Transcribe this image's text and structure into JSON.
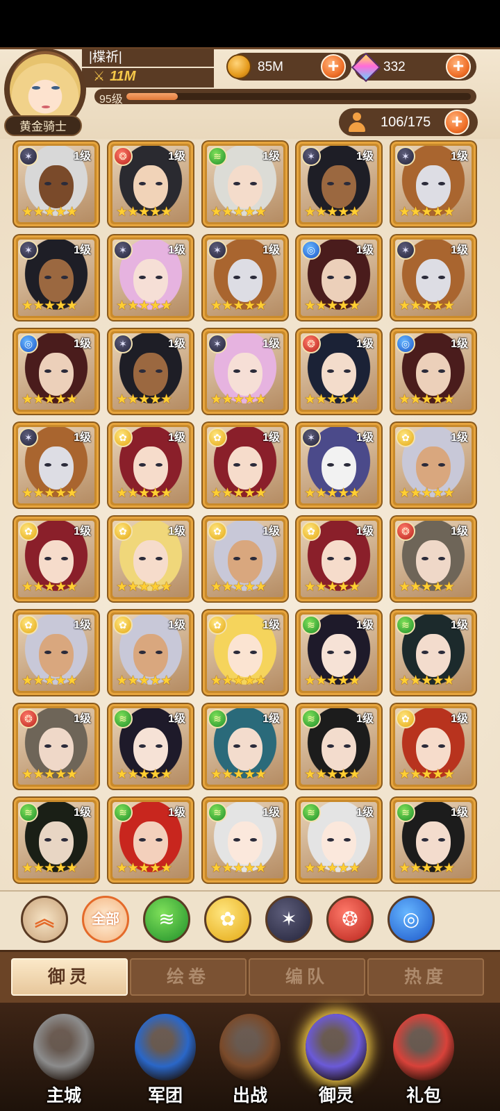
{
  "player": {
    "name": "|楪祈|",
    "power": "11M",
    "level_label": "95级",
    "level_progress": 0.15,
    "rank_title": "黄金骑士"
  },
  "resources": {
    "coins": "85M",
    "gems": "332",
    "roster_count": "106/175"
  },
  "colors": {
    "accent": "#f0712a",
    "frame": "#e7a53e",
    "brown": "#5a3b24"
  },
  "heroes": [
    {
      "element": "dark",
      "level": "1级",
      "stars": "★★★★★",
      "hair": "#d8d8d8",
      "skin": "#7a4a2a"
    },
    {
      "element": "fire",
      "level": "1级",
      "stars": "★★★★★",
      "hair": "#2a2a30",
      "skin": "#f1d3b8"
    },
    {
      "element": "wind",
      "level": "1级",
      "stars": "★★★★★",
      "hair": "#dcdcd6",
      "skin": "#f4dccb"
    },
    {
      "element": "dark",
      "level": "1级",
      "stars": "★★★★★",
      "hair": "#1e1e26",
      "skin": "#9b6840"
    },
    {
      "element": "dark",
      "level": "1级",
      "stars": "★★★★★",
      "hair": "#a9652f",
      "skin": "#dddde4"
    },
    {
      "element": "dark",
      "level": "1级",
      "stars": "★★★★★",
      "hair": "#1e1e26",
      "skin": "#9b6840"
    },
    {
      "element": "dark",
      "level": "1级",
      "stars": "★★★★★",
      "hair": "#e6b3e0",
      "skin": "#f6dfd6"
    },
    {
      "element": "dark",
      "level": "1级",
      "stars": "★★★★★",
      "hair": "#a9652f",
      "skin": "#dddde4"
    },
    {
      "element": "water",
      "level": "1级",
      "stars": "★★★★★",
      "hair": "#4a1c1c",
      "skin": "#ecd0ba"
    },
    {
      "element": "dark",
      "level": "1级",
      "stars": "★★★★★",
      "hair": "#a9652f",
      "skin": "#dddde4"
    },
    {
      "element": "water",
      "level": "1级",
      "stars": "★★★★★",
      "hair": "#4a1c1c",
      "skin": "#ecd0ba"
    },
    {
      "element": "dark",
      "level": "1级",
      "stars": "★★★★★",
      "hair": "#1e1e26",
      "skin": "#9b6840"
    },
    {
      "element": "dark",
      "level": "1级",
      "stars": "★★★★★",
      "hair": "#e6b3e0",
      "skin": "#f6dfd6"
    },
    {
      "element": "fire",
      "level": "1级",
      "stars": "★★★★★",
      "hair": "#1b2236",
      "skin": "#f3dccb"
    },
    {
      "element": "water",
      "level": "1级",
      "stars": "★★★★★",
      "hair": "#4a1c1c",
      "skin": "#ecd0ba"
    },
    {
      "element": "dark",
      "level": "1级",
      "stars": "★★★★★",
      "hair": "#a9652f",
      "skin": "#dddde4"
    },
    {
      "element": "light",
      "level": "1级",
      "stars": "★★★★★",
      "hair": "#8a1f2a",
      "skin": "#f6dccb"
    },
    {
      "element": "light",
      "level": "1级",
      "stars": "★★★★★",
      "hair": "#8a1f2a",
      "skin": "#f6dccb"
    },
    {
      "element": "dark",
      "level": "1级",
      "stars": "★★★★★",
      "hair": "#4b4a8a",
      "skin": "#f2f2f2"
    },
    {
      "element": "light",
      "level": "1级",
      "stars": "★★★★★",
      "hair": "#c8c8d8",
      "skin": "#d9a77e"
    },
    {
      "element": "light",
      "level": "1级",
      "stars": "★★★★★",
      "hair": "#8a1f2a",
      "skin": "#f6dccb"
    },
    {
      "element": "light",
      "level": "1级",
      "stars": "★★★★★",
      "hair": "#f0d77a",
      "skin": "#f6dccb"
    },
    {
      "element": "light",
      "level": "1级",
      "stars": "★★★★★",
      "hair": "#c8c8d8",
      "skin": "#d9a77e"
    },
    {
      "element": "light",
      "level": "1级",
      "stars": "★★★★★",
      "hair": "#8a1f2a",
      "skin": "#f6dccb"
    },
    {
      "element": "fire",
      "level": "1级",
      "stars": "★★★★★",
      "hair": "#6e6558",
      "skin": "#efd8c8"
    },
    {
      "element": "light",
      "level": "1级",
      "stars": "★★★★★",
      "hair": "#c8c8d8",
      "skin": "#d9a77e"
    },
    {
      "element": "light",
      "level": "1级",
      "stars": "★★★★★",
      "hair": "#c8c8d8",
      "skin": "#d9a77e"
    },
    {
      "element": "light",
      "level": "1级",
      "stars": "★★★★★",
      "hair": "#f5d45c",
      "skin": "#fbe4d2"
    },
    {
      "element": "wind",
      "level": "1级",
      "stars": "★★★★★",
      "hair": "#1e1a2a",
      "skin": "#f6e2d6"
    },
    {
      "element": "wind",
      "level": "1级",
      "stars": "★★★★★",
      "hair": "#1c2a2c",
      "skin": "#f3dccd"
    },
    {
      "element": "fire",
      "level": "1级",
      "stars": "★★★★★",
      "hair": "#6e6558",
      "skin": "#efd8c8"
    },
    {
      "element": "wind",
      "level": "1级",
      "stars": "★★★★★",
      "hair": "#1e1a2a",
      "skin": "#f6e2d6"
    },
    {
      "element": "wind",
      "level": "1级",
      "stars": "★★★★★",
      "hair": "#2a6a7a",
      "skin": "#f3dccd"
    },
    {
      "element": "wind",
      "level": "1级",
      "stars": "★★★★★",
      "hair": "#1c1c1c",
      "skin": "#f3dccd"
    },
    {
      "element": "light",
      "level": "1级",
      "stars": "★★★★★",
      "hair": "#b8331e",
      "skin": "#f6dccb"
    },
    {
      "element": "wind",
      "level": "1级",
      "stars": "★★★★★",
      "hair": "#1a1f16",
      "skin": "#e8d6c4"
    },
    {
      "element": "wind",
      "level": "1级",
      "stars": "★★★★★",
      "hair": "#c8261e",
      "skin": "#f3d0bc"
    },
    {
      "element": "wind",
      "level": "1级",
      "stars": "★★★★★",
      "hair": "#e4e4e4",
      "skin": "#fbe8dc"
    },
    {
      "element": "wind",
      "level": "1级",
      "stars": "★★★★★",
      "hair": "#e4e4e4",
      "skin": "#fbe8dc"
    },
    {
      "element": "wind",
      "level": "1级",
      "stars": "★★★★★",
      "hair": "#1c1c1c",
      "skin": "#f3dccd"
    }
  ],
  "element_icons": {
    "wind": "≋",
    "light": "✿",
    "dark": "✶",
    "fire": "❂",
    "water": "◎"
  },
  "filters": {
    "collapse_icon": "︽",
    "all_label": "全部",
    "items": [
      {
        "element": "wind",
        "icon": "≋"
      },
      {
        "element": "light",
        "icon": "✿"
      },
      {
        "element": "dark",
        "icon": "✶"
      },
      {
        "element": "fire",
        "icon": "❂"
      },
      {
        "element": "water",
        "icon": "◎"
      }
    ]
  },
  "tabs": [
    "御灵",
    "绘卷",
    "编队",
    "热度"
  ],
  "nav": [
    {
      "label": "主城",
      "color": "#8c8c8c"
    },
    {
      "label": "军团",
      "color": "#2a67c8"
    },
    {
      "label": "出战",
      "color": "#7a4a2a"
    },
    {
      "label": "御灵",
      "color": "#6b5ad8"
    },
    {
      "label": "礼包",
      "color": "#d8423a"
    }
  ]
}
